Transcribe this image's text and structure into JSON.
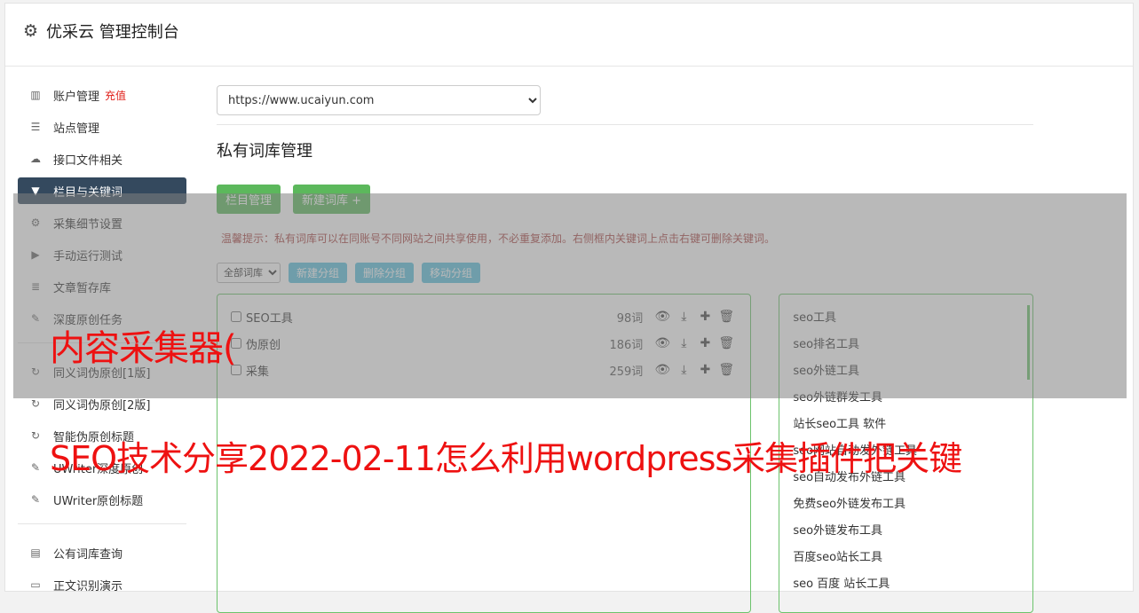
{
  "header": {
    "title": "优采云 管理控制台",
    "icon": "gear-icon"
  },
  "sidebar": {
    "items": [
      {
        "label": "账户管理",
        "badge": "充值",
        "icon": "bar-chart-icon"
      },
      {
        "label": "站点管理",
        "icon": "server-icon"
      },
      {
        "label": "接口文件相关",
        "icon": "cloud-upload-icon"
      },
      {
        "label": "栏目与关键词",
        "icon": "filter-icon",
        "active": true
      },
      {
        "label": "采集细节设置",
        "icon": "cogs-icon"
      },
      {
        "label": "手动运行测试",
        "icon": "play-circle-icon"
      },
      {
        "label": "文章暂存库",
        "icon": "database-icon"
      },
      {
        "label": "深度原创任务",
        "icon": "edit-icon"
      },
      {
        "label": "同义词伪原创[1版]",
        "icon": "refresh-icon"
      },
      {
        "label": "同义词伪原创[2版]",
        "icon": "refresh-icon"
      },
      {
        "label": "智能伪原创标题",
        "icon": "refresh-icon"
      },
      {
        "label": "UWriter深度原创",
        "icon": "edit-icon"
      },
      {
        "label": "UWriter原创标题",
        "icon": "edit-icon"
      },
      {
        "label": "公有词库查询",
        "icon": "book-icon"
      },
      {
        "label": "正文识别演示",
        "icon": "monitor-icon"
      }
    ]
  },
  "main": {
    "site_select": "https://www.ucaiyun.com",
    "section_title": "私有词库管理",
    "btn_column": "栏目管理",
    "btn_new_lib": "新建词库 +",
    "tip": "温馨提示：私有词库可以在同账号不同网站之间共享使用，不必重复添加。右侧框内关键词上点击右键可删除关键词。",
    "group_select": "全部词库",
    "btn_new_group": "新建分组",
    "btn_del_group": "删除分组",
    "btn_move_group": "移动分组",
    "libraries": [
      {
        "name": "SEO工具",
        "count": "98词"
      },
      {
        "name": "伪原创",
        "count": "186词"
      },
      {
        "name": "采集",
        "count": "259词"
      }
    ],
    "keywords": [
      "seo工具",
      "seo排名工具",
      "seo外链工具",
      "seo外链群发工具",
      "站长seo工具 软件",
      "seo网站自动发外链工具",
      "seo自动发布外链工具",
      "免费seo外链发布工具",
      "seo外链发布工具",
      "百度seo站长工具",
      "seo 百度 站长工具"
    ]
  },
  "overlay": {
    "line1": "内容采集器(",
    "line2": "SEO技术分享2022-02-11怎么利用wordpress采集插件把关键"
  }
}
